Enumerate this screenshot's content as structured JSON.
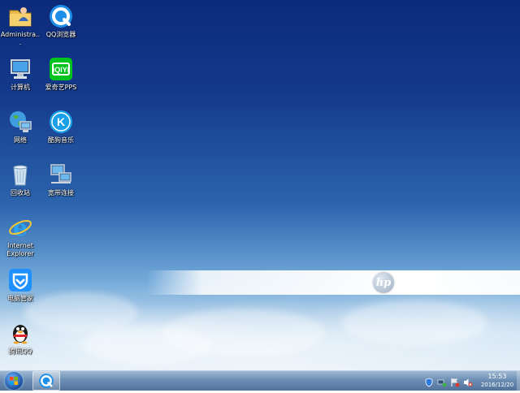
{
  "desktop": {
    "icons": [
      {
        "label": "Administra..."
      },
      {
        "label": "QQ浏览器"
      },
      {
        "label": "计算机"
      },
      {
        "label": "爱奇艺PPS"
      },
      {
        "label": "网络"
      },
      {
        "label": "酷狗音乐"
      },
      {
        "label": "回收站"
      },
      {
        "label": "宽带连接"
      },
      {
        "label": "Internet Explorer"
      },
      {
        "label": "电脑管家"
      },
      {
        "label": "腾讯QQ"
      }
    ],
    "wallpaper_logo": "hp"
  },
  "taskbar": {
    "clock": {
      "time": "15:53",
      "date": "2016/12/20"
    },
    "tray_icons": [
      "shield-icon",
      "network-icon",
      "flag-icon",
      "volume-muted-icon"
    ]
  },
  "colors": {
    "sky_top": "#0b2a7a",
    "taskbar": "#6e8fb4",
    "iqiyi_green": "#00c31e",
    "kugou_blue": "#1aa0e8",
    "tencent_blue": "#1e90ff"
  }
}
